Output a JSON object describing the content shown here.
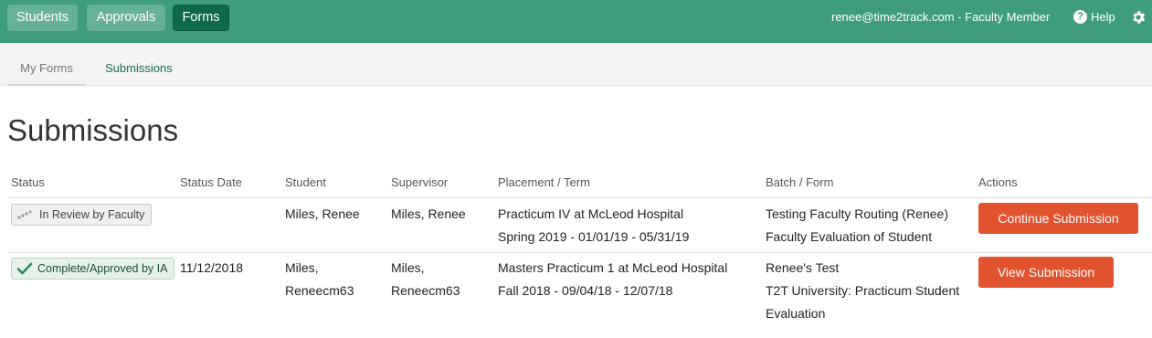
{
  "topnav": {
    "students": "Students",
    "approvals": "Approvals",
    "forms": "Forms",
    "user": "renee@time2track.com - Faculty Member",
    "help": "Help"
  },
  "subnav": {
    "my_forms": "My Forms",
    "submissions": "Submissions"
  },
  "page_title": "Submissions",
  "table": {
    "headers": {
      "status": "Status",
      "status_date": "Status Date",
      "student": "Student",
      "supervisor": "Supervisor",
      "placement": "Placement / Term",
      "batch": "Batch / Form",
      "actions": "Actions"
    },
    "rows": [
      {
        "status": "In Review by Faculty",
        "status_date": "",
        "student": "Miles, Renee",
        "student_line2": "",
        "supervisor": "Miles, Renee",
        "supervisor_line2": "",
        "placement": "Practicum IV at McLeod Hospital",
        "term": "Spring 2019 - 01/01/19 - 05/31/19",
        "batch": "Testing Faculty Routing (Renee)",
        "form": "Faculty Evaluation of Student",
        "form_line2": "",
        "action": "Continue Submission"
      },
      {
        "status": "Complete/Approved by IA",
        "status_date": "11/12/2018",
        "student": "Miles,",
        "student_line2": "Reneecm63",
        "supervisor": "Miles,",
        "supervisor_line2": "Reneecm63",
        "placement": "Masters Practicum 1 at McLeod Hospital",
        "term": "Fall 2018 - 09/04/18 - 12/07/18",
        "batch": "Renee's Test",
        "form": "T2T University: Practicum Student",
        "form_line2": "Evaluation",
        "action": "View Submission"
      }
    ]
  },
  "colors": {
    "topbar": "#3f9c7c",
    "active_nav": "#0f6a4c",
    "action": "#e3522e"
  },
  "icons": {
    "help": "question-circle-icon",
    "settings": "gear-icon",
    "review": "pending-dots-icon",
    "complete": "checkmark-icon"
  }
}
